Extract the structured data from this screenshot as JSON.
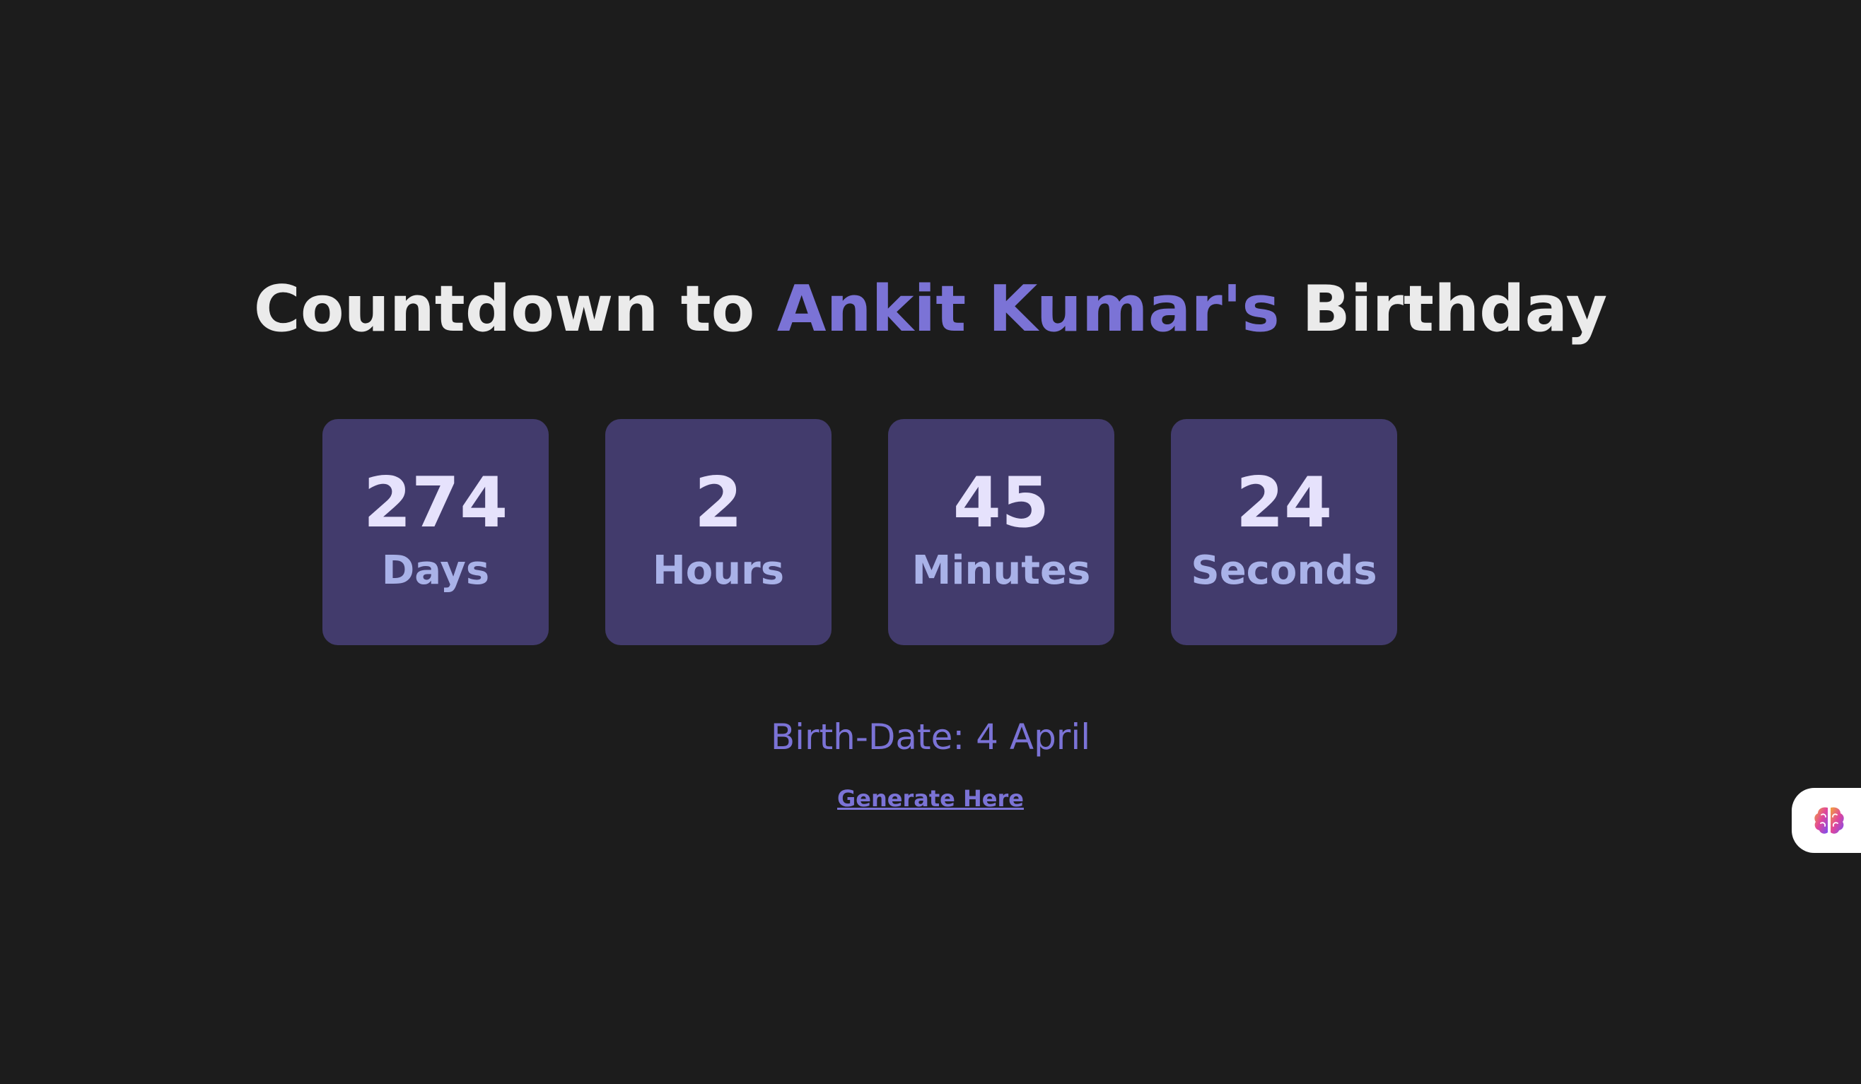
{
  "header": {
    "title_prefix": "Countdown to ",
    "title_name": "Ankit Kumar's",
    "title_suffix": " Birthday"
  },
  "countdown": [
    {
      "value": "274",
      "unit": "Days"
    },
    {
      "value": "2",
      "unit": "Hours"
    },
    {
      "value": "45",
      "unit": "Minutes"
    },
    {
      "value": "24",
      "unit": "Seconds"
    }
  ],
  "birth_date": "Birth-Date: 4 April",
  "generate_link": "Generate Here",
  "widget": {
    "icon": "brain-icon"
  },
  "colors": {
    "background": "#1c1c1c",
    "accent": "#7b73d6",
    "box": "#423b6c",
    "number": "#e6e2fc",
    "unit": "#a9b2e8",
    "title": "#ebebeb"
  }
}
